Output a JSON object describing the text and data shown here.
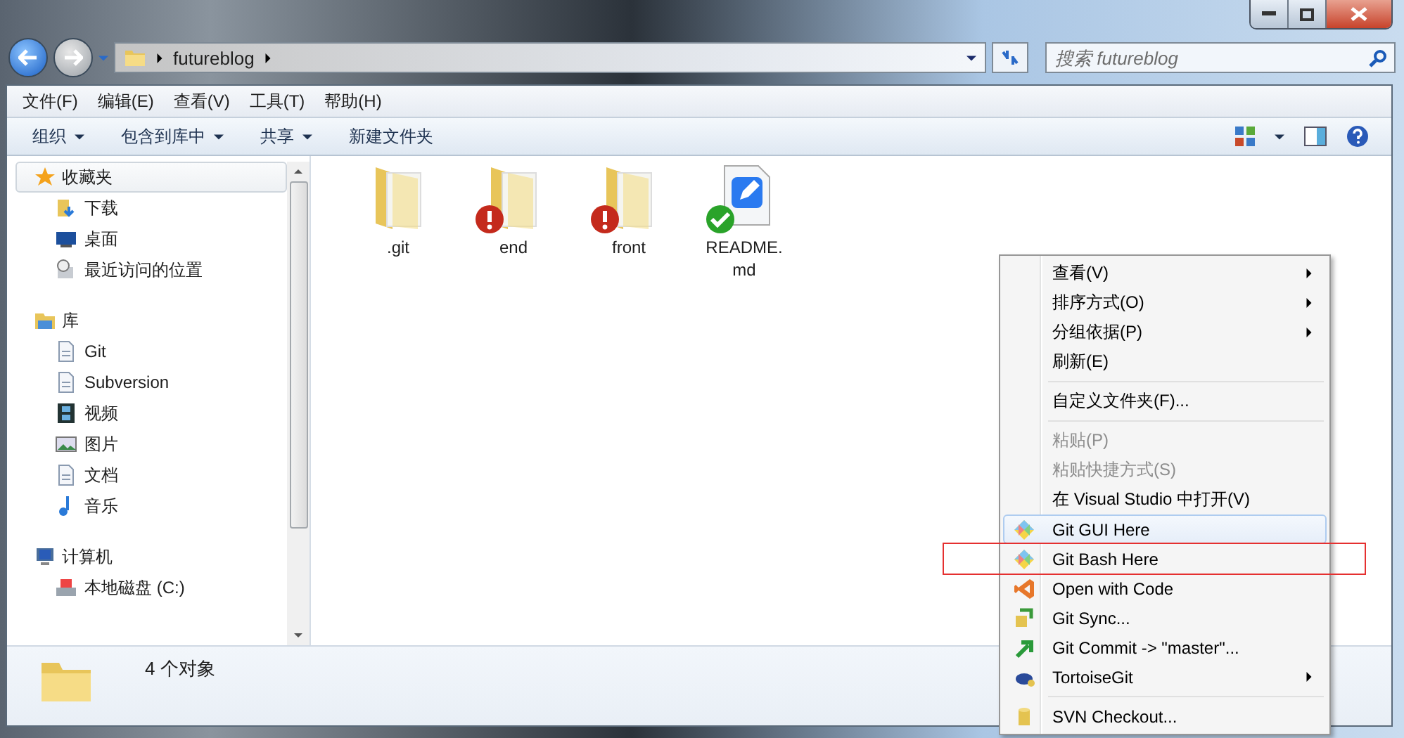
{
  "address": {
    "crumbs": [
      "futureblog"
    ]
  },
  "search": {
    "placeholder": "搜索 futureblog"
  },
  "menubar": [
    "文件(F)",
    "编辑(E)",
    "查看(V)",
    "工具(T)",
    "帮助(H)"
  ],
  "toolbar": [
    {
      "label": "组织",
      "dropdown": true
    },
    {
      "label": "包含到库中",
      "dropdown": true
    },
    {
      "label": "共享",
      "dropdown": true
    },
    {
      "label": "新建文件夹",
      "dropdown": false
    }
  ],
  "sidebar": [
    {
      "label": "收藏夹",
      "kind": "favorites",
      "selected": true,
      "children": [
        {
          "label": "下载",
          "kind": "download",
          "selected": false
        },
        {
          "label": "桌面",
          "kind": "desktop",
          "selected": false
        },
        {
          "label": "最近访问的位置",
          "kind": "recent",
          "selected": false
        }
      ]
    },
    {
      "label": "库",
      "kind": "library",
      "selected": false,
      "children": [
        {
          "label": "Git",
          "kind": "doc",
          "selected": false
        },
        {
          "label": "Subversion",
          "kind": "doc",
          "selected": false
        },
        {
          "label": "视频",
          "kind": "video",
          "selected": false
        },
        {
          "label": "图片",
          "kind": "picture",
          "selected": false
        },
        {
          "label": "文档",
          "kind": "doc",
          "selected": false
        },
        {
          "label": "音乐",
          "kind": "music",
          "selected": false
        }
      ]
    },
    {
      "label": "计算机",
      "kind": "computer",
      "selected": false,
      "children": [
        {
          "label": "本地磁盘 (C:)",
          "kind": "drive",
          "selected": false
        }
      ]
    }
  ],
  "files": [
    {
      "name": ".git",
      "kind": "folder"
    },
    {
      "name": "end",
      "kind": "conflicted-folder"
    },
    {
      "name": "front",
      "kind": "conflicted-folder"
    },
    {
      "name": "README.\nmd",
      "kind": "clean-file"
    }
  ],
  "status_bar": {
    "count": "4 个对象"
  },
  "context_menu": [
    {
      "kind": "text",
      "label": "查看(V)",
      "submenu": true,
      "disabled": false,
      "hovered": false,
      "annotated": false
    },
    {
      "kind": "text",
      "label": "排序方式(O)",
      "submenu": true,
      "disabled": false,
      "hovered": false,
      "annotated": false
    },
    {
      "kind": "text",
      "label": "分组依据(P)",
      "submenu": true,
      "disabled": false,
      "hovered": false,
      "annotated": false
    },
    {
      "kind": "text",
      "label": "刷新(E)",
      "submenu": false,
      "disabled": false,
      "hovered": false,
      "annotated": false
    },
    {
      "kind": "separator"
    },
    {
      "kind": "text",
      "label": "自定义文件夹(F)...",
      "submenu": false,
      "disabled": false,
      "hovered": false,
      "annotated": false
    },
    {
      "kind": "separator"
    },
    {
      "kind": "text",
      "label": "粘贴(P)",
      "submenu": false,
      "disabled": true,
      "hovered": false,
      "annotated": false
    },
    {
      "kind": "text",
      "label": "粘贴快捷方式(S)",
      "submenu": false,
      "disabled": true,
      "hovered": false,
      "annotated": false
    },
    {
      "kind": "text",
      "label": "在 Visual Studio 中打开(V)",
      "submenu": false,
      "disabled": false,
      "hovered": false,
      "annotated": false
    },
    {
      "kind": "git",
      "label": "Git GUI Here",
      "submenu": false,
      "disabled": false,
      "hovered": true,
      "annotated": false
    },
    {
      "kind": "git",
      "label": "Git Bash Here",
      "submenu": false,
      "disabled": false,
      "hovered": false,
      "annotated": true
    },
    {
      "kind": "vscode",
      "label": "Open with Code",
      "submenu": false,
      "disabled": false,
      "hovered": false,
      "annotated": false
    },
    {
      "kind": "sync",
      "label": "Git Sync...",
      "submenu": false,
      "disabled": false,
      "hovered": false,
      "annotated": false
    },
    {
      "kind": "commit",
      "label": "Git Commit -> \"master\"...",
      "submenu": false,
      "disabled": false,
      "hovered": false,
      "annotated": false
    },
    {
      "kind": "tortoise",
      "label": "TortoiseGit",
      "submenu": true,
      "disabled": false,
      "hovered": false,
      "annotated": false
    },
    {
      "kind": "separator"
    },
    {
      "kind": "svn",
      "label": "SVN Checkout...",
      "submenu": false,
      "disabled": false,
      "hovered": false,
      "annotated": false
    }
  ]
}
